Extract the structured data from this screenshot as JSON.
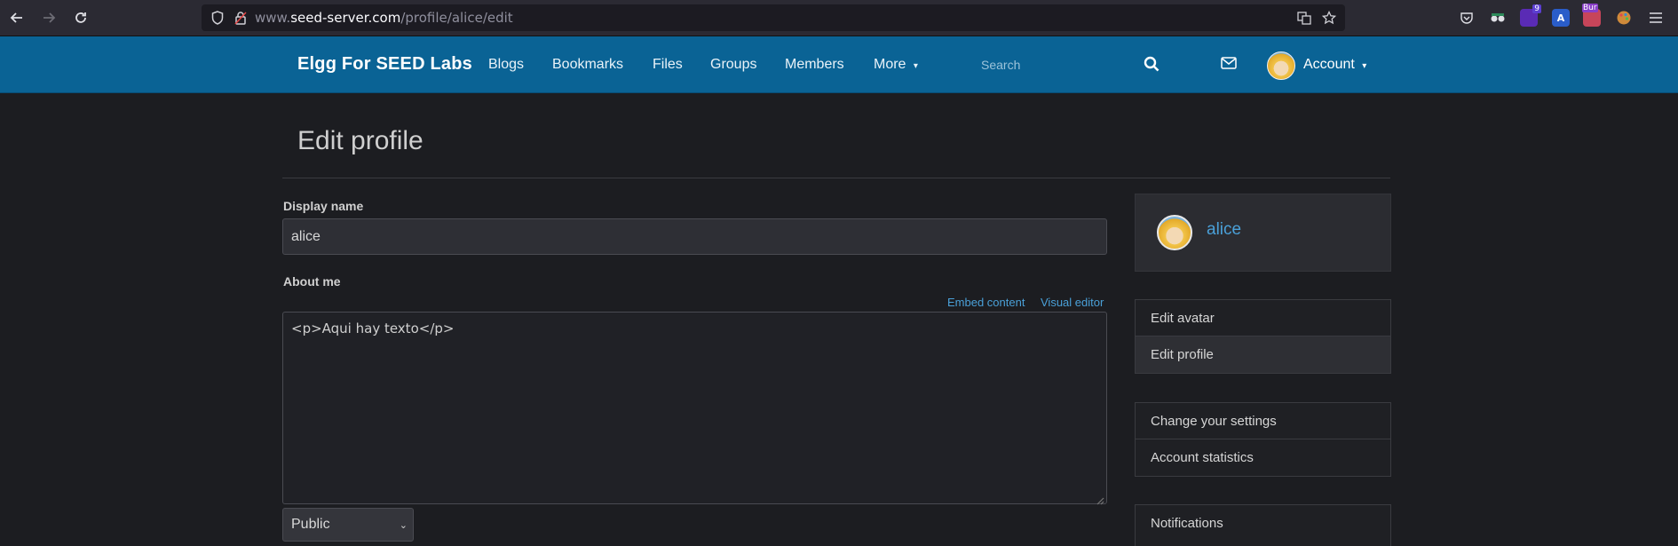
{
  "browser": {
    "url_prefix": "www.",
    "url_host": "seed-server.com",
    "url_path": "/profile/alice/edit",
    "extension_badge_count": "9",
    "extension_badge_text": "Bur"
  },
  "header": {
    "brand": "Elgg For SEED Labs",
    "nav": {
      "blogs": "Blogs",
      "bookmarks": "Bookmarks",
      "files": "Files",
      "groups": "Groups",
      "members": "Members",
      "more": "More"
    },
    "search_placeholder": "Search",
    "account_label": "Account"
  },
  "page": {
    "title": "Edit profile",
    "display_name_label": "Display name",
    "display_name_value": "alice",
    "about_me_label": "About me",
    "embed_content": "Embed content",
    "visual_editor": "Visual editor",
    "about_me_value": "<p>Aqui hay texto</p>",
    "access_value": "Public"
  },
  "sidebar": {
    "owner_name": "alice",
    "group1": [
      "Edit avatar",
      "Edit profile"
    ],
    "group2": [
      "Change your settings",
      "Account statistics"
    ],
    "group3": [
      "Notifications"
    ]
  },
  "colors": {
    "header_bg": "#0a6395",
    "link": "#4aa0d8",
    "page_bg": "#1c1d21"
  }
}
